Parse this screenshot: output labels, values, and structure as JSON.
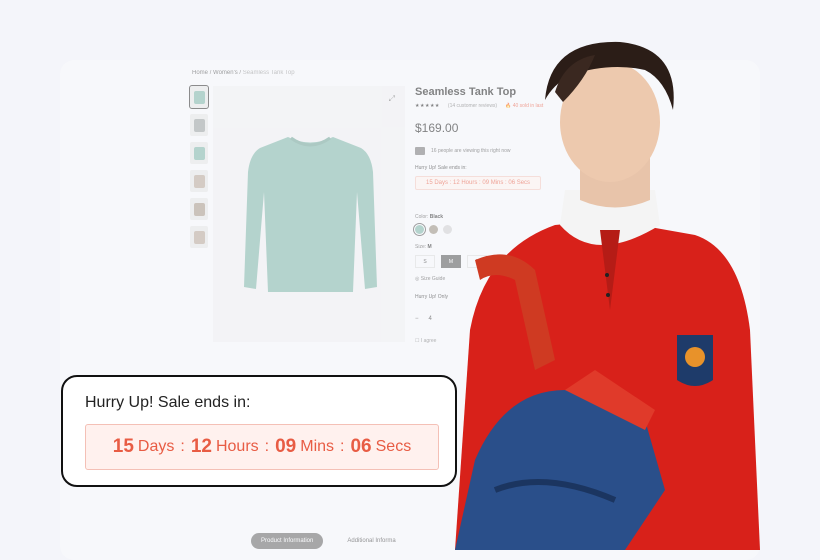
{
  "breadcrumb": {
    "home": "Home",
    "section": "Women's",
    "current": "Seamless Tank Top",
    "sep": "/"
  },
  "product": {
    "title": "Seamless Tank Top",
    "stars": "★★★★★",
    "reviews": "(14 customer reviews)",
    "sold": "40 sold in last",
    "price": "$169.00",
    "viewing": "16 people are viewing this right now",
    "hurry_label": "Hurry Up! Sale ends in:",
    "countdown_small": "15 Days : 12 Hours : 09 Mins : 06 Secs",
    "color_label": "Color:",
    "color_value": "Black",
    "size_label": "Size:",
    "size_value": "M",
    "sizes": [
      "S",
      "M",
      "L"
    ],
    "size_guide": "Size Guide",
    "hurry_only": "Hurry Up! Only",
    "qty_minus": "−",
    "qty_value": "4",
    "agree": "I agree"
  },
  "tabs": {
    "active": "Product Information",
    "other": "Additional Informa"
  },
  "popup": {
    "title": "Hurry Up! Sale ends in:",
    "days": "15",
    "days_label": "Days",
    "hours": "12",
    "hours_label": "Hours",
    "mins": "09",
    "mins_label": "Mins",
    "secs": "06",
    "secs_label": "Secs",
    "sep": ":"
  },
  "colors": {
    "accent": "#e85c44",
    "sweater": "#7fb5a8",
    "sweater_dark": "#6fa396",
    "jacket": "#d8211a",
    "boot": "#2a4f8a"
  }
}
